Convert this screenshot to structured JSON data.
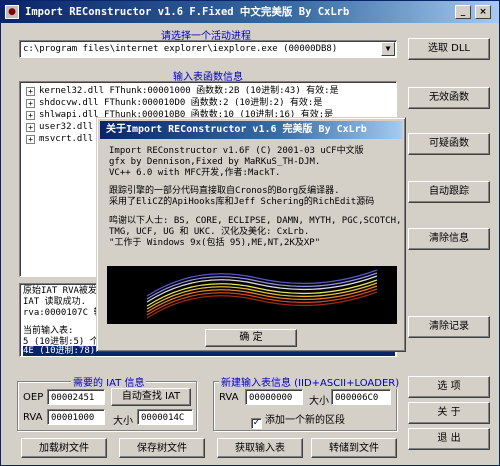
{
  "window": {
    "title": "Import REConstructor v1.6 F.Fixed 中文完美版 By CxLrb",
    "controls": {
      "minimize": "_",
      "close": "×"
    }
  },
  "process": {
    "label": "请选择一个活动进程",
    "selected": "c:\\program files\\internet explorer\\iexplore.exe (00000DB8)"
  },
  "imports": {
    "label": "输入表函数信息",
    "rows": [
      "kernel32.dll FThunk:00001000 函数数:2B (10进制:43) 有效:是",
      "shdocvw.dll FThunk:000010D0 函数数:2 (10进制:2) 有效:是",
      "shlwapi.dll FThunk:000010B0 函数数:10 (10进制:16) 有效:是",
      "user32.dll FThunk:0000117",
      "msvcrt.dll FThunk:000010"
    ]
  },
  "log": {
    "rows": [
      "原始IAT RVA被发现",
      "IAT 读取成功.",
      "rva:0000107C 转",
      "",
      "当前输入表:",
      "5 (10进制:5) 个",
      "4E (10进制:78)"
    ]
  },
  "iat": {
    "label": "需要的 IAT 信息",
    "oep_label": "OEP",
    "oep_value": "00002451",
    "autofind_label": "自动查找 IAT",
    "rva_label": "RVA",
    "rva_value": "00001000",
    "size_label": "大小",
    "size_value": "0000014C"
  },
  "newimport": {
    "label": "新建输入表信息 (IID+ASCII+LOADER)",
    "rva_label": "RVA",
    "rva_value": "00000000",
    "size_label": "大小",
    "size_value": "000006C0",
    "add_section_label": "添加一个新的区段",
    "add_section_checked": true
  },
  "right_buttons": {
    "select_dll": "选取 DLL",
    "invalid_func": "无效函数",
    "suspicious_func": "可疑函数",
    "auto_trace": "自动跟踪",
    "clear_info": "清除信息",
    "clear_log": "清除记录",
    "options": "选 项",
    "about": "关 于",
    "exit": "退 出"
  },
  "bottom_buttons": {
    "load_tree": "加载树文件",
    "save_tree": "保存树文件",
    "get_imports": "获取输入表",
    "fix_dump": "转储到文件"
  },
  "about": {
    "title": "关于Import REConstructor v1.6 完美版 By CxLrb",
    "lines": [
      "Import REConstructor v1.6F (C) 2001-03 uCF中文版",
      "gfx by Dennison,Fixed by MaRKuS_TH-DJM.",
      "VC++ 6.0 with MFC开发,作者:MackT.",
      "",
      "跟踪引擎的一部分代码直接取自Cronos的Borg反编译器.",
      "采用了EliCZ的ApiHooks库和Jeff Schering的RichEdit源码",
      "",
      "鸣谢以下人士: BS, CORE, ECLIPSE, DAMN, MYTH, PGC,SCOTCH,",
      "TMG, UCF, UG 和 UKC. 汉化及美化: CxLrb.",
      "\"工作于 Windows 9x(包括 95),ME,NT,2K及XP\""
    ],
    "ok_label": "确 定"
  }
}
